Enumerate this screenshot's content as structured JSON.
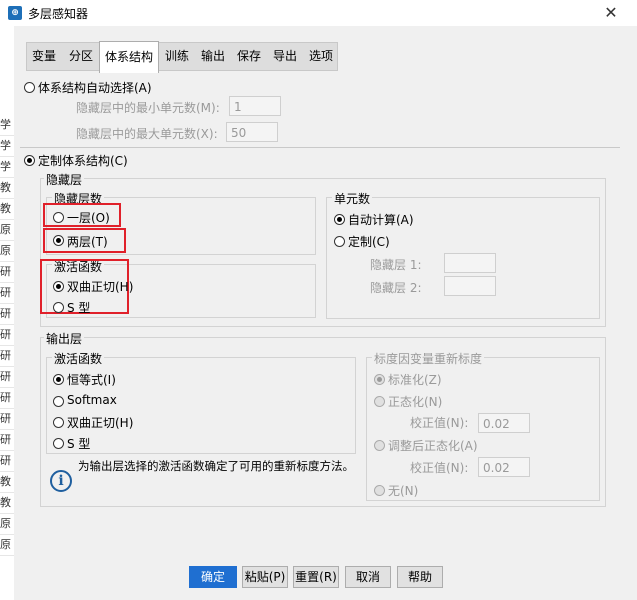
{
  "window": {
    "title": "多层感知器",
    "close_glyph": "✕"
  },
  "background_rows": [
    "学",
    "学",
    "学",
    "教",
    "教",
    "原",
    "原",
    "研",
    "研",
    "研",
    "研",
    "研",
    "研",
    "研",
    "研",
    "研",
    "研",
    "教",
    "教",
    "原",
    "原"
  ],
  "tabs": [
    "变量",
    "分区",
    "体系结构",
    "训练",
    "输出",
    "保存",
    "导出",
    "选项"
  ],
  "auto_arch": {
    "label": "体系结构自动选择(A)",
    "min_units_label": "隐藏层中的最小单元数(M):",
    "min_units_value": "1",
    "max_units_label": "隐藏层中的最大单元数(X):",
    "max_units_value": "50"
  },
  "custom_arch": {
    "label": "定制体系结构(C)",
    "hidden_section": "隐藏层",
    "layers_group": "隐藏层数",
    "one_layer": "一层(O)",
    "two_layers": "两层(T)",
    "activation_group": "激活函数",
    "tanh": "双曲正切(H)",
    "sigmoid": "S 型",
    "units_group": "单元数",
    "auto_compute": "自动计算(A)",
    "custom": "定制(C)",
    "hidden1": "隐藏层 1:",
    "hidden2": "隐藏层 2:"
  },
  "output_layer": {
    "section": "输出层",
    "activation_group": "激活函数",
    "identity": "恒等式(I)",
    "softmax": "Softmax",
    "tanh": "双曲正切(H)",
    "sigmoid": "S 型",
    "info_text": "为输出层选择的激活函数确定了可用的重新标度方法。",
    "rescale_group": "标度因变量重新标度",
    "standardize": "标准化(Z)",
    "normalize": "正态化(N)",
    "correction1_label": "校正值(N):",
    "correction1_value": "0.02",
    "adj_normalize": "调整后正态化(A)",
    "correction2_label": "校正值(N):",
    "correction2_value": "0.02",
    "none": "无(N)"
  },
  "buttons": {
    "ok": "确定",
    "paste": "粘贴(P)",
    "reset": "重置(R)",
    "cancel": "取消",
    "help": "帮助"
  }
}
